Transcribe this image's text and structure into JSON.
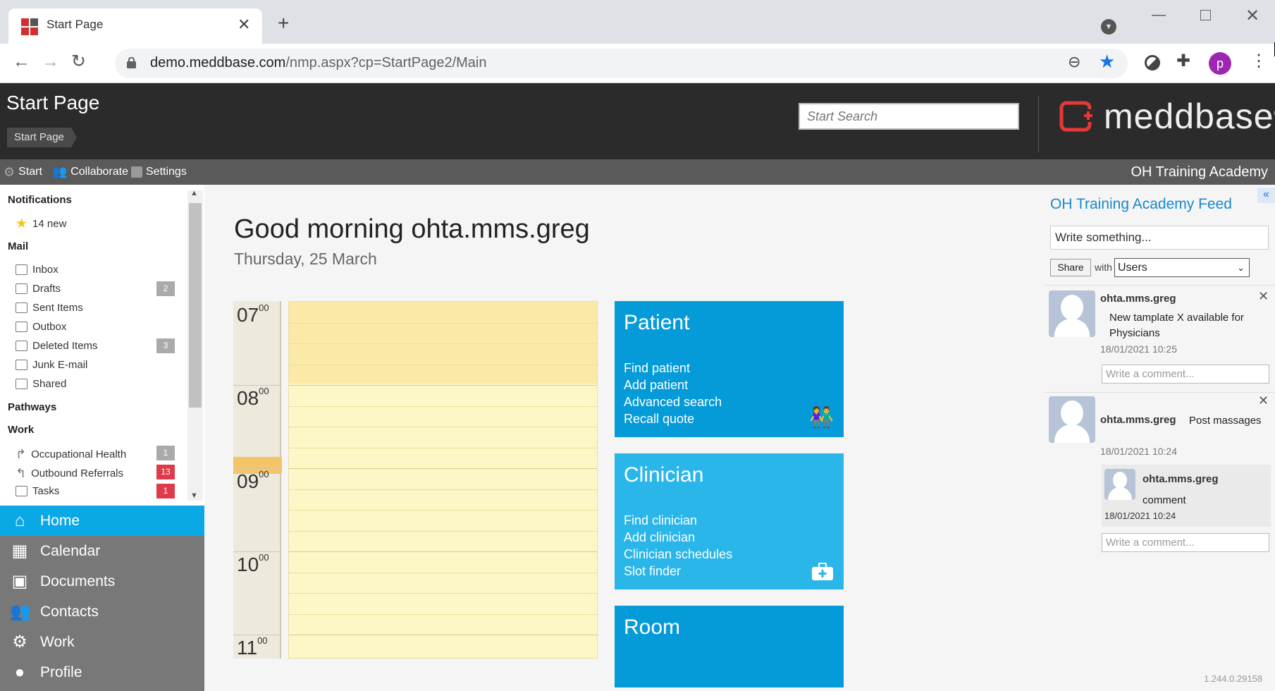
{
  "browser": {
    "tab_title": "Start Page",
    "url_host": "demo.meddbase.com",
    "url_path": "/nmp.aspx?cp=StartPage2/Main",
    "profile_initial": "p"
  },
  "header": {
    "page_title": "Start Page",
    "breadcrumb": "Start Page",
    "search_placeholder": "Start Search",
    "logo_text": "meddbase",
    "logo_mark": "®"
  },
  "topnav": {
    "items": [
      {
        "label": "Start",
        "icon": "gear-icon"
      },
      {
        "label": "Collaborate",
        "icon": "people-icon"
      },
      {
        "label": "Settings",
        "icon": "settings-doc-icon"
      }
    ],
    "org_name": "OH Training Academy"
  },
  "sidebar": {
    "notifications": {
      "heading": "Notifications",
      "new_label": "14 new"
    },
    "mail": {
      "heading": "Mail",
      "items": [
        {
          "label": "Inbox",
          "badge": ""
        },
        {
          "label": "Drafts",
          "badge": "2"
        },
        {
          "label": "Sent Items",
          "badge": ""
        },
        {
          "label": "Outbox",
          "badge": ""
        },
        {
          "label": "Deleted Items",
          "badge": "3"
        },
        {
          "label": "Junk E-mail",
          "badge": ""
        },
        {
          "label": "Shared",
          "badge": ""
        }
      ]
    },
    "pathways_heading": "Pathways",
    "work": {
      "heading": "Work",
      "items": [
        {
          "label": "Occupational Health",
          "badge": "1",
          "badge_color": "#aaaaaa"
        },
        {
          "label": "Outbound Referrals",
          "badge": "13",
          "badge_color": "#dd3a4a"
        },
        {
          "label": "Tasks",
          "badge": "1",
          "badge_color": "#dd3a4a"
        }
      ]
    }
  },
  "bottomnav": {
    "items": [
      {
        "label": "Home",
        "active": true
      },
      {
        "label": "Calendar",
        "active": false
      },
      {
        "label": "Documents",
        "active": false
      },
      {
        "label": "Contacts",
        "active": false
      },
      {
        "label": "Work",
        "active": false
      },
      {
        "label": "Profile",
        "active": false
      }
    ]
  },
  "main": {
    "greeting": "Good morning ohta.mms.greg",
    "date": "Thursday, 25 March",
    "calendar": {
      "hours": [
        "07",
        "08",
        "09",
        "10",
        "11"
      ],
      "minutes": "00"
    },
    "tiles": {
      "patient": {
        "title": "Patient",
        "links": [
          "Find patient",
          "Add patient",
          "Advanced search",
          "Recall quote"
        ],
        "color": "#049bd8"
      },
      "clinician": {
        "title": "Clinician",
        "links": [
          "Find clinician",
          "Add clinician",
          "Clinician schedules",
          "Slot finder"
        ],
        "color": "#2bb6ea"
      },
      "room": {
        "title": "Room",
        "links": [],
        "color": "#049bd8"
      }
    }
  },
  "feed": {
    "title": "OH Training Academy Feed",
    "write_placeholder": "Write something...",
    "share_label": "Share",
    "with_label": "with",
    "audience": "Users",
    "comment_placeholder": "Write a comment...",
    "posts": [
      {
        "author": "ohta.mms.greg",
        "text": "New tamplate X available for Physicians",
        "time": "18/01/2021 10:25"
      },
      {
        "author": "ohta.mms.greg",
        "text": "Post massages",
        "time": "18/01/2021 10:24",
        "reply": {
          "author": "ohta.mms.greg",
          "text": "comment",
          "time": "18/01/2021 10:24"
        }
      }
    ],
    "version": "1.244.0.29158"
  }
}
